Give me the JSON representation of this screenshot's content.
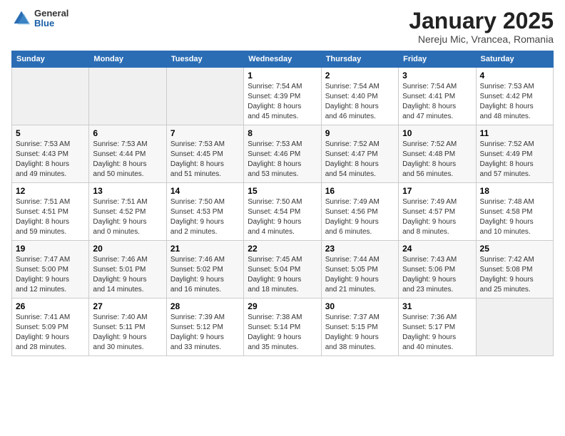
{
  "header": {
    "logo": {
      "general": "General",
      "blue": "Blue"
    },
    "title": "January 2025",
    "location": "Nereju Mic, Vrancea, Romania"
  },
  "days_of_week": [
    "Sunday",
    "Monday",
    "Tuesday",
    "Wednesday",
    "Thursday",
    "Friday",
    "Saturday"
  ],
  "weeks": [
    [
      {
        "day": "",
        "info": ""
      },
      {
        "day": "",
        "info": ""
      },
      {
        "day": "",
        "info": ""
      },
      {
        "day": "1",
        "info": "Sunrise: 7:54 AM\nSunset: 4:39 PM\nDaylight: 8 hours\nand 45 minutes."
      },
      {
        "day": "2",
        "info": "Sunrise: 7:54 AM\nSunset: 4:40 PM\nDaylight: 8 hours\nand 46 minutes."
      },
      {
        "day": "3",
        "info": "Sunrise: 7:54 AM\nSunset: 4:41 PM\nDaylight: 8 hours\nand 47 minutes."
      },
      {
        "day": "4",
        "info": "Sunrise: 7:53 AM\nSunset: 4:42 PM\nDaylight: 8 hours\nand 48 minutes."
      }
    ],
    [
      {
        "day": "5",
        "info": "Sunrise: 7:53 AM\nSunset: 4:43 PM\nDaylight: 8 hours\nand 49 minutes."
      },
      {
        "day": "6",
        "info": "Sunrise: 7:53 AM\nSunset: 4:44 PM\nDaylight: 8 hours\nand 50 minutes."
      },
      {
        "day": "7",
        "info": "Sunrise: 7:53 AM\nSunset: 4:45 PM\nDaylight: 8 hours\nand 51 minutes."
      },
      {
        "day": "8",
        "info": "Sunrise: 7:53 AM\nSunset: 4:46 PM\nDaylight: 8 hours\nand 53 minutes."
      },
      {
        "day": "9",
        "info": "Sunrise: 7:52 AM\nSunset: 4:47 PM\nDaylight: 8 hours\nand 54 minutes."
      },
      {
        "day": "10",
        "info": "Sunrise: 7:52 AM\nSunset: 4:48 PM\nDaylight: 8 hours\nand 56 minutes."
      },
      {
        "day": "11",
        "info": "Sunrise: 7:52 AM\nSunset: 4:49 PM\nDaylight: 8 hours\nand 57 minutes."
      }
    ],
    [
      {
        "day": "12",
        "info": "Sunrise: 7:51 AM\nSunset: 4:51 PM\nDaylight: 8 hours\nand 59 minutes."
      },
      {
        "day": "13",
        "info": "Sunrise: 7:51 AM\nSunset: 4:52 PM\nDaylight: 9 hours\nand 0 minutes."
      },
      {
        "day": "14",
        "info": "Sunrise: 7:50 AM\nSunset: 4:53 PM\nDaylight: 9 hours\nand 2 minutes."
      },
      {
        "day": "15",
        "info": "Sunrise: 7:50 AM\nSunset: 4:54 PM\nDaylight: 9 hours\nand 4 minutes."
      },
      {
        "day": "16",
        "info": "Sunrise: 7:49 AM\nSunset: 4:56 PM\nDaylight: 9 hours\nand 6 minutes."
      },
      {
        "day": "17",
        "info": "Sunrise: 7:49 AM\nSunset: 4:57 PM\nDaylight: 9 hours\nand 8 minutes."
      },
      {
        "day": "18",
        "info": "Sunrise: 7:48 AM\nSunset: 4:58 PM\nDaylight: 9 hours\nand 10 minutes."
      }
    ],
    [
      {
        "day": "19",
        "info": "Sunrise: 7:47 AM\nSunset: 5:00 PM\nDaylight: 9 hours\nand 12 minutes."
      },
      {
        "day": "20",
        "info": "Sunrise: 7:46 AM\nSunset: 5:01 PM\nDaylight: 9 hours\nand 14 minutes."
      },
      {
        "day": "21",
        "info": "Sunrise: 7:46 AM\nSunset: 5:02 PM\nDaylight: 9 hours\nand 16 minutes."
      },
      {
        "day": "22",
        "info": "Sunrise: 7:45 AM\nSunset: 5:04 PM\nDaylight: 9 hours\nand 18 minutes."
      },
      {
        "day": "23",
        "info": "Sunrise: 7:44 AM\nSunset: 5:05 PM\nDaylight: 9 hours\nand 21 minutes."
      },
      {
        "day": "24",
        "info": "Sunrise: 7:43 AM\nSunset: 5:06 PM\nDaylight: 9 hours\nand 23 minutes."
      },
      {
        "day": "25",
        "info": "Sunrise: 7:42 AM\nSunset: 5:08 PM\nDaylight: 9 hours\nand 25 minutes."
      }
    ],
    [
      {
        "day": "26",
        "info": "Sunrise: 7:41 AM\nSunset: 5:09 PM\nDaylight: 9 hours\nand 28 minutes."
      },
      {
        "day": "27",
        "info": "Sunrise: 7:40 AM\nSunset: 5:11 PM\nDaylight: 9 hours\nand 30 minutes."
      },
      {
        "day": "28",
        "info": "Sunrise: 7:39 AM\nSunset: 5:12 PM\nDaylight: 9 hours\nand 33 minutes."
      },
      {
        "day": "29",
        "info": "Sunrise: 7:38 AM\nSunset: 5:14 PM\nDaylight: 9 hours\nand 35 minutes."
      },
      {
        "day": "30",
        "info": "Sunrise: 7:37 AM\nSunset: 5:15 PM\nDaylight: 9 hours\nand 38 minutes."
      },
      {
        "day": "31",
        "info": "Sunrise: 7:36 AM\nSunset: 5:17 PM\nDaylight: 9 hours\nand 40 minutes."
      },
      {
        "day": "",
        "info": ""
      }
    ]
  ]
}
